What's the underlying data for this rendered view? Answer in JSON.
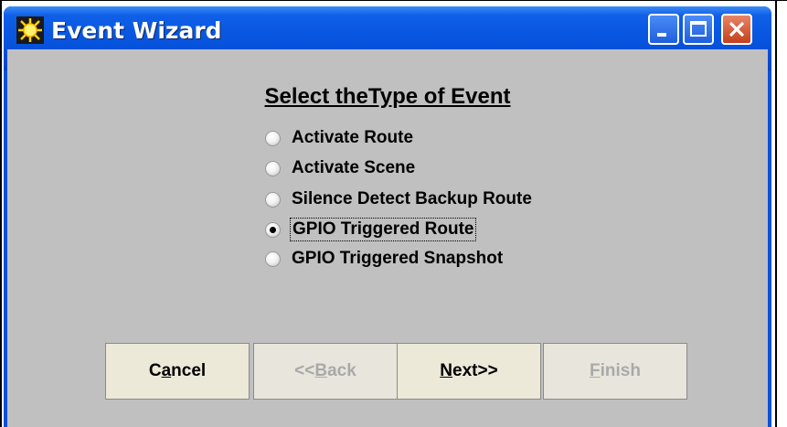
{
  "window": {
    "title": "Event Wizard",
    "icon": "sun-icon"
  },
  "titlebar_buttons": {
    "minimize": "minimize-icon",
    "maximize": "maximize-icon",
    "close": "close-icon"
  },
  "heading": "Select theType of Event",
  "options": [
    {
      "label": "Activate Route",
      "checked": false
    },
    {
      "label": "Activate Scene",
      "checked": false
    },
    {
      "label": "Silence Detect Backup Route",
      "checked": false
    },
    {
      "label": "GPIO Triggered Route",
      "checked": true
    },
    {
      "label": "GPIO Triggered Snapshot",
      "checked": false
    }
  ],
  "buttons": {
    "cancel": {
      "pre": "C",
      "u": "a",
      "post": "ncel",
      "enabled": true
    },
    "back": {
      "pre": "<<",
      "u": "B",
      "post": "ack",
      "enabled": false
    },
    "next": {
      "pre": "",
      "u": "N",
      "post": "ext>>",
      "enabled": true
    },
    "finish": {
      "pre": "",
      "u": "F",
      "post": "inish",
      "enabled": false
    }
  }
}
